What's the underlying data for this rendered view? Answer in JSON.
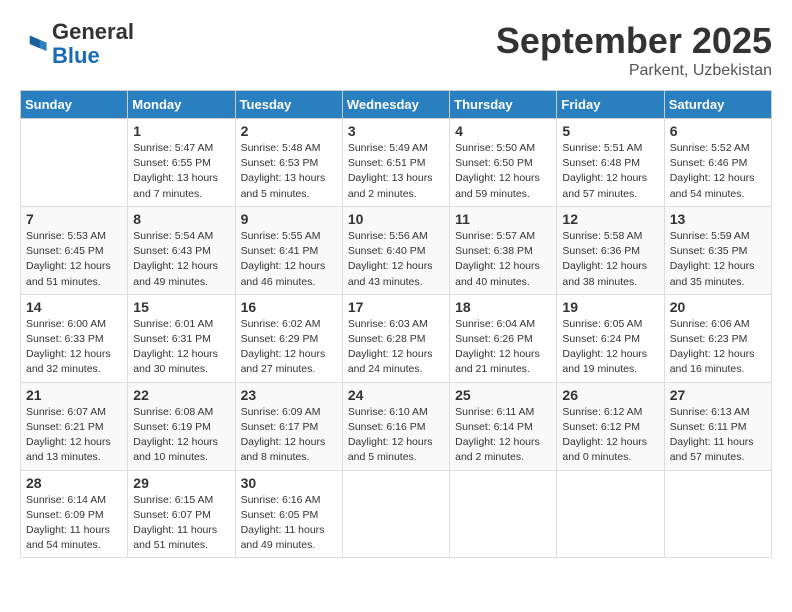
{
  "logo": {
    "general": "General",
    "blue": "Blue"
  },
  "header": {
    "month": "September 2025",
    "location": "Parkent, Uzbekistan"
  },
  "weekdays": [
    "Sunday",
    "Monday",
    "Tuesday",
    "Wednesday",
    "Thursday",
    "Friday",
    "Saturday"
  ],
  "weeks": [
    [
      {
        "day": "",
        "info": ""
      },
      {
        "day": "1",
        "info": "Sunrise: 5:47 AM\nSunset: 6:55 PM\nDaylight: 13 hours\nand 7 minutes."
      },
      {
        "day": "2",
        "info": "Sunrise: 5:48 AM\nSunset: 6:53 PM\nDaylight: 13 hours\nand 5 minutes."
      },
      {
        "day": "3",
        "info": "Sunrise: 5:49 AM\nSunset: 6:51 PM\nDaylight: 13 hours\nand 2 minutes."
      },
      {
        "day": "4",
        "info": "Sunrise: 5:50 AM\nSunset: 6:50 PM\nDaylight: 12 hours\nand 59 minutes."
      },
      {
        "day": "5",
        "info": "Sunrise: 5:51 AM\nSunset: 6:48 PM\nDaylight: 12 hours\nand 57 minutes."
      },
      {
        "day": "6",
        "info": "Sunrise: 5:52 AM\nSunset: 6:46 PM\nDaylight: 12 hours\nand 54 minutes."
      }
    ],
    [
      {
        "day": "7",
        "info": "Sunrise: 5:53 AM\nSunset: 6:45 PM\nDaylight: 12 hours\nand 51 minutes."
      },
      {
        "day": "8",
        "info": "Sunrise: 5:54 AM\nSunset: 6:43 PM\nDaylight: 12 hours\nand 49 minutes."
      },
      {
        "day": "9",
        "info": "Sunrise: 5:55 AM\nSunset: 6:41 PM\nDaylight: 12 hours\nand 46 minutes."
      },
      {
        "day": "10",
        "info": "Sunrise: 5:56 AM\nSunset: 6:40 PM\nDaylight: 12 hours\nand 43 minutes."
      },
      {
        "day": "11",
        "info": "Sunrise: 5:57 AM\nSunset: 6:38 PM\nDaylight: 12 hours\nand 40 minutes."
      },
      {
        "day": "12",
        "info": "Sunrise: 5:58 AM\nSunset: 6:36 PM\nDaylight: 12 hours\nand 38 minutes."
      },
      {
        "day": "13",
        "info": "Sunrise: 5:59 AM\nSunset: 6:35 PM\nDaylight: 12 hours\nand 35 minutes."
      }
    ],
    [
      {
        "day": "14",
        "info": "Sunrise: 6:00 AM\nSunset: 6:33 PM\nDaylight: 12 hours\nand 32 minutes."
      },
      {
        "day": "15",
        "info": "Sunrise: 6:01 AM\nSunset: 6:31 PM\nDaylight: 12 hours\nand 30 minutes."
      },
      {
        "day": "16",
        "info": "Sunrise: 6:02 AM\nSunset: 6:29 PM\nDaylight: 12 hours\nand 27 minutes."
      },
      {
        "day": "17",
        "info": "Sunrise: 6:03 AM\nSunset: 6:28 PM\nDaylight: 12 hours\nand 24 minutes."
      },
      {
        "day": "18",
        "info": "Sunrise: 6:04 AM\nSunset: 6:26 PM\nDaylight: 12 hours\nand 21 minutes."
      },
      {
        "day": "19",
        "info": "Sunrise: 6:05 AM\nSunset: 6:24 PM\nDaylight: 12 hours\nand 19 minutes."
      },
      {
        "day": "20",
        "info": "Sunrise: 6:06 AM\nSunset: 6:23 PM\nDaylight: 12 hours\nand 16 minutes."
      }
    ],
    [
      {
        "day": "21",
        "info": "Sunrise: 6:07 AM\nSunset: 6:21 PM\nDaylight: 12 hours\nand 13 minutes."
      },
      {
        "day": "22",
        "info": "Sunrise: 6:08 AM\nSunset: 6:19 PM\nDaylight: 12 hours\nand 10 minutes."
      },
      {
        "day": "23",
        "info": "Sunrise: 6:09 AM\nSunset: 6:17 PM\nDaylight: 12 hours\nand 8 minutes."
      },
      {
        "day": "24",
        "info": "Sunrise: 6:10 AM\nSunset: 6:16 PM\nDaylight: 12 hours\nand 5 minutes."
      },
      {
        "day": "25",
        "info": "Sunrise: 6:11 AM\nSunset: 6:14 PM\nDaylight: 12 hours\nand 2 minutes."
      },
      {
        "day": "26",
        "info": "Sunrise: 6:12 AM\nSunset: 6:12 PM\nDaylight: 12 hours\nand 0 minutes."
      },
      {
        "day": "27",
        "info": "Sunrise: 6:13 AM\nSunset: 6:11 PM\nDaylight: 11 hours\nand 57 minutes."
      }
    ],
    [
      {
        "day": "28",
        "info": "Sunrise: 6:14 AM\nSunset: 6:09 PM\nDaylight: 11 hours\nand 54 minutes."
      },
      {
        "day": "29",
        "info": "Sunrise: 6:15 AM\nSunset: 6:07 PM\nDaylight: 11 hours\nand 51 minutes."
      },
      {
        "day": "30",
        "info": "Sunrise: 6:16 AM\nSunset: 6:05 PM\nDaylight: 11 hours\nand 49 minutes."
      },
      {
        "day": "",
        "info": ""
      },
      {
        "day": "",
        "info": ""
      },
      {
        "day": "",
        "info": ""
      },
      {
        "day": "",
        "info": ""
      }
    ]
  ]
}
